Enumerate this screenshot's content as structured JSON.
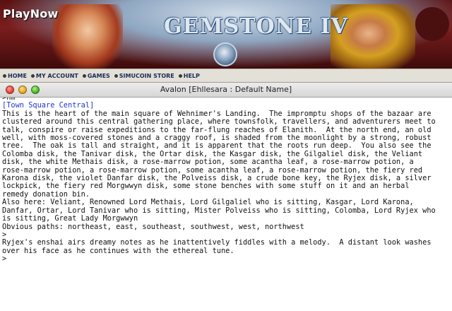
{
  "banner": {
    "playnow": "PlayNow",
    "logo": "GEMSTONE IV"
  },
  "nav": {
    "items": [
      {
        "label": "HOME"
      },
      {
        "label": "MY ACCOUNT"
      },
      {
        "label": "GAMES"
      },
      {
        "label": "SIMUCOIN STORE"
      },
      {
        "label": "HELP"
      }
    ]
  },
  "window": {
    "title": "Avalon [Ehllesara : Default Name]"
  },
  "terminal": {
    "lines": [
      {
        "text": ">nm",
        "style": "prompt-cut"
      },
      {
        "text": "[Town Square Central]",
        "style": "room-title"
      },
      {
        "text": "This is the heart of the main square of Wehnimer's Landing.  The impromptu shops of the bazaar are"
      },
      {
        "text": "clustered around this central gathering place, where townsfolk, travellers, and adventurers meet to"
      },
      {
        "text": "talk, conspire or raise expeditions to the far-flung reaches of Elanith.  At the north end, an old"
      },
      {
        "text": "well, with moss-covered stones and a craggy roof, is shaded from the moonlight by a strong, robust"
      },
      {
        "text": "tree.  The oak is tall and straight, and it is apparent that the roots run deep.  You also see the"
      },
      {
        "text": "Colomba disk, the Tanivar disk, the Ortar disk, the Kasgar disk, the Gilgaliel disk, the Veliant"
      },
      {
        "text": "disk, the white Methais disk, a rose-marrow potion, some acantha leaf, a rose-marrow potion, a"
      },
      {
        "text": "rose-marrow potion, a rose-marrow potion, some acantha leaf, a rose-marrow potion, the fiery red"
      },
      {
        "text": "Karona disk, the violet Danfar disk, the Polveiss disk, a crude bone key, the Ryjex disk, a silver"
      },
      {
        "text": "lockpick, the fiery red Morgwwyn disk, some stone benches with some stuff on it and an herbal"
      },
      {
        "text": "remedy donation bin."
      },
      {
        "text": "Also here: Veliant, Renowned Lord Methais, Lord Gilgaliel who is sitting, Kasgar, Lord Karona,"
      },
      {
        "text": "Danfar, Ortar, Lord Tanivar who is sitting, Mister Polveiss who is sitting, Colomba, Lord Ryjex who"
      },
      {
        "text": "is sitting, Great Lady Morgwwyn"
      },
      {
        "text": "Obvious paths: northeast, east, southeast, southwest, west, northwest"
      },
      {
        "text": ">"
      },
      {
        "text": "Ryjex's enshai airs dreamy notes as he inattentively fiddles with a melody.  A distant look washes"
      },
      {
        "text": "over his face as he continues with the ethereal tune."
      },
      {
        "text": ">"
      }
    ]
  },
  "colors": {
    "room_title": "#2233cc",
    "banner_bg": "#5a1111",
    "nav_text": "#1c2a55"
  }
}
